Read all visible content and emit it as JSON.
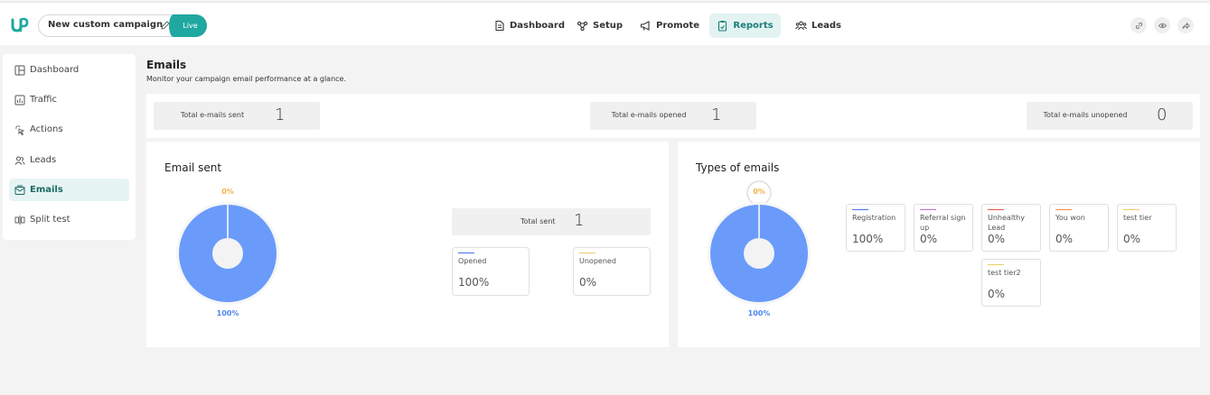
{
  "header": {
    "campaign_name": "New custom campaign",
    "status": "Live",
    "nav": [
      {
        "label": "Dashboard",
        "icon": "dashboard-icon"
      },
      {
        "label": "Setup",
        "icon": "setup-icon"
      },
      {
        "label": "Promote",
        "icon": "megaphone-icon"
      },
      {
        "label": "Reports",
        "icon": "clipboard-icon",
        "active": true
      },
      {
        "label": "Leads",
        "icon": "people-icon"
      }
    ],
    "actions": [
      "link-icon",
      "eye-icon",
      "share-icon"
    ]
  },
  "sidebar": {
    "items": [
      {
        "label": "Dashboard",
        "icon": "layout-icon"
      },
      {
        "label": "Traffic",
        "icon": "bar-chart-icon"
      },
      {
        "label": "Actions",
        "icon": "cursor-click-icon"
      },
      {
        "label": "Leads",
        "icon": "users-icon"
      },
      {
        "label": "Emails",
        "icon": "envelope-icon",
        "active": true
      },
      {
        "label": "Split test",
        "icon": "split-icon"
      }
    ]
  },
  "page": {
    "title": "Emails",
    "subtitle": "Monitor your campaign email performance at a glance."
  },
  "stats": [
    {
      "label": "Total e-mails sent",
      "value": "1"
    },
    {
      "label": "Total e-mails opened",
      "value": "1"
    },
    {
      "label": "Total e-mails unopened",
      "value": "0"
    }
  ],
  "email_sent": {
    "title": "Email sent",
    "total_label": "Total sent",
    "total_value": "1",
    "top_label": "0%",
    "bottom_label": "100%",
    "boxes": [
      {
        "label": "Opened",
        "value": "100%",
        "color": "#4e6ee8"
      },
      {
        "label": "Unopened",
        "value": "0%",
        "color": "#f5c76a"
      }
    ]
  },
  "types_of_emails": {
    "title": "Types of emails",
    "top_label": "0%",
    "bottom_label": "100%",
    "boxes": [
      {
        "label": "Registration",
        "value": "100%",
        "color": "#4e6ee8"
      },
      {
        "label": "Referral sign up",
        "value": "0%",
        "color": "#c56bd8"
      },
      {
        "label": "Unhealthy Lead",
        "value": "0%",
        "color": "#e0594a"
      },
      {
        "label": "You won",
        "value": "0%",
        "color": "#f08a5a"
      },
      {
        "label": "test tier",
        "value": "0%",
        "color": "#f5c76a"
      },
      {
        "label": "test tier2",
        "value": "0%",
        "color": "#e8d35a"
      }
    ]
  },
  "chart_data": [
    {
      "type": "pie",
      "title": "Email sent",
      "categories": [
        "Opened",
        "Unopened"
      ],
      "values": [
        100,
        0
      ],
      "colors": [
        "#6a9bfb",
        "#f5b04a"
      ]
    },
    {
      "type": "pie",
      "title": "Types of emails",
      "categories": [
        "Registration",
        "Referral sign up",
        "Unhealthy Lead",
        "You won",
        "test tier",
        "test tier2"
      ],
      "values": [
        100,
        0,
        0,
        0,
        0,
        0
      ],
      "colors": [
        "#6a9bfb",
        "#c56bd8",
        "#e0594a",
        "#f08a5a",
        "#f5c76a",
        "#e8d35a"
      ]
    }
  ]
}
